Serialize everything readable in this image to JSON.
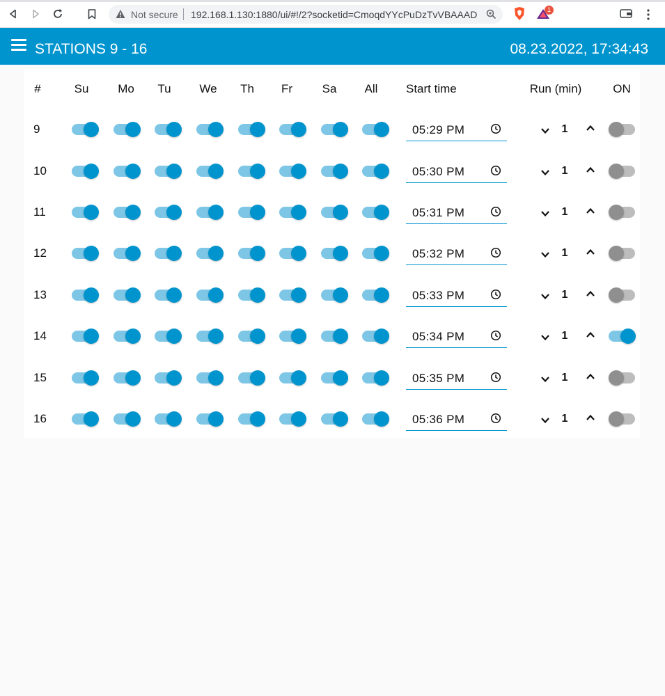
{
  "browser": {
    "not_secure": "Not secure",
    "url": "192.168.1.130:1880/ui/#!/2?socketid=CmoqdYYcPuDzTvVBAAAD",
    "ext_badge": "1"
  },
  "header": {
    "title": "STATIONS 9 - 16",
    "datetime": "08.23.2022, 17:34:43"
  },
  "colors": {
    "accent": "#0094ce",
    "accent_light": "#7dc6e6",
    "off_thumb": "#8f8f8f",
    "off_track": "#bdbdbd"
  },
  "table": {
    "columns": [
      "#",
      "Su",
      "Mo",
      "Tu",
      "We",
      "Th",
      "Fr",
      "Sa",
      "All",
      "Start time",
      "Run (min)",
      "ON"
    ],
    "rows": [
      {
        "station": "9",
        "days": [
          true,
          true,
          true,
          true,
          true,
          true,
          true,
          true
        ],
        "start": "05:29  PM",
        "run": "1",
        "on": false
      },
      {
        "station": "10",
        "days": [
          true,
          true,
          true,
          true,
          true,
          true,
          true,
          true
        ],
        "start": "05:30  PM",
        "run": "1",
        "on": false
      },
      {
        "station": "11",
        "days": [
          true,
          true,
          true,
          true,
          true,
          true,
          true,
          true
        ],
        "start": "05:31  PM",
        "run": "1",
        "on": false
      },
      {
        "station": "12",
        "days": [
          true,
          true,
          true,
          true,
          true,
          true,
          true,
          true
        ],
        "start": "05:32  PM",
        "run": "1",
        "on": false
      },
      {
        "station": "13",
        "days": [
          true,
          true,
          true,
          true,
          true,
          true,
          true,
          true
        ],
        "start": "05:33  PM",
        "run": "1",
        "on": false
      },
      {
        "station": "14",
        "days": [
          true,
          true,
          true,
          true,
          true,
          true,
          true,
          true
        ],
        "start": "05:34  PM",
        "run": "1",
        "on": true
      },
      {
        "station": "15",
        "days": [
          true,
          true,
          true,
          true,
          true,
          true,
          true,
          true
        ],
        "start": "05:35  PM",
        "run": "1",
        "on": false
      },
      {
        "station": "16",
        "days": [
          true,
          true,
          true,
          true,
          true,
          true,
          true,
          true
        ],
        "start": "05:36  PM",
        "run": "1",
        "on": false
      }
    ]
  }
}
